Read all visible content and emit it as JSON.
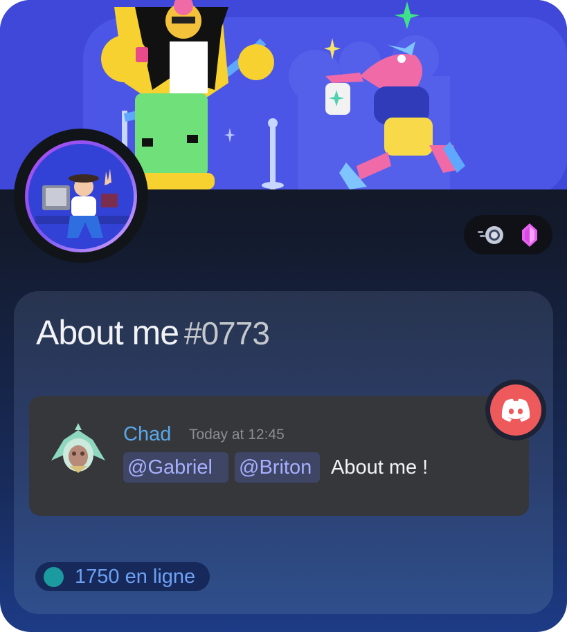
{
  "profile": {
    "title": "About me",
    "discriminator": "#0773"
  },
  "message": {
    "username": "Chad",
    "timestamp": "Today at 12:45",
    "mentions": [
      "@Gabriel",
      "@Briton"
    ],
    "text": "About me !"
  },
  "status": {
    "online_text": "1750 en ligne"
  },
  "icons": {
    "badge_1": "hypesquad-speed-badge-icon",
    "badge_2": "nitro-gem-badge-icon",
    "discord": "discord-logo-icon"
  },
  "colors": {
    "banner": "#3f48d8",
    "username": "#5aa7e8",
    "mention": "#a6b0ff",
    "discord_button": "#ee5a5c",
    "online_dot": "#1b9aa0"
  }
}
